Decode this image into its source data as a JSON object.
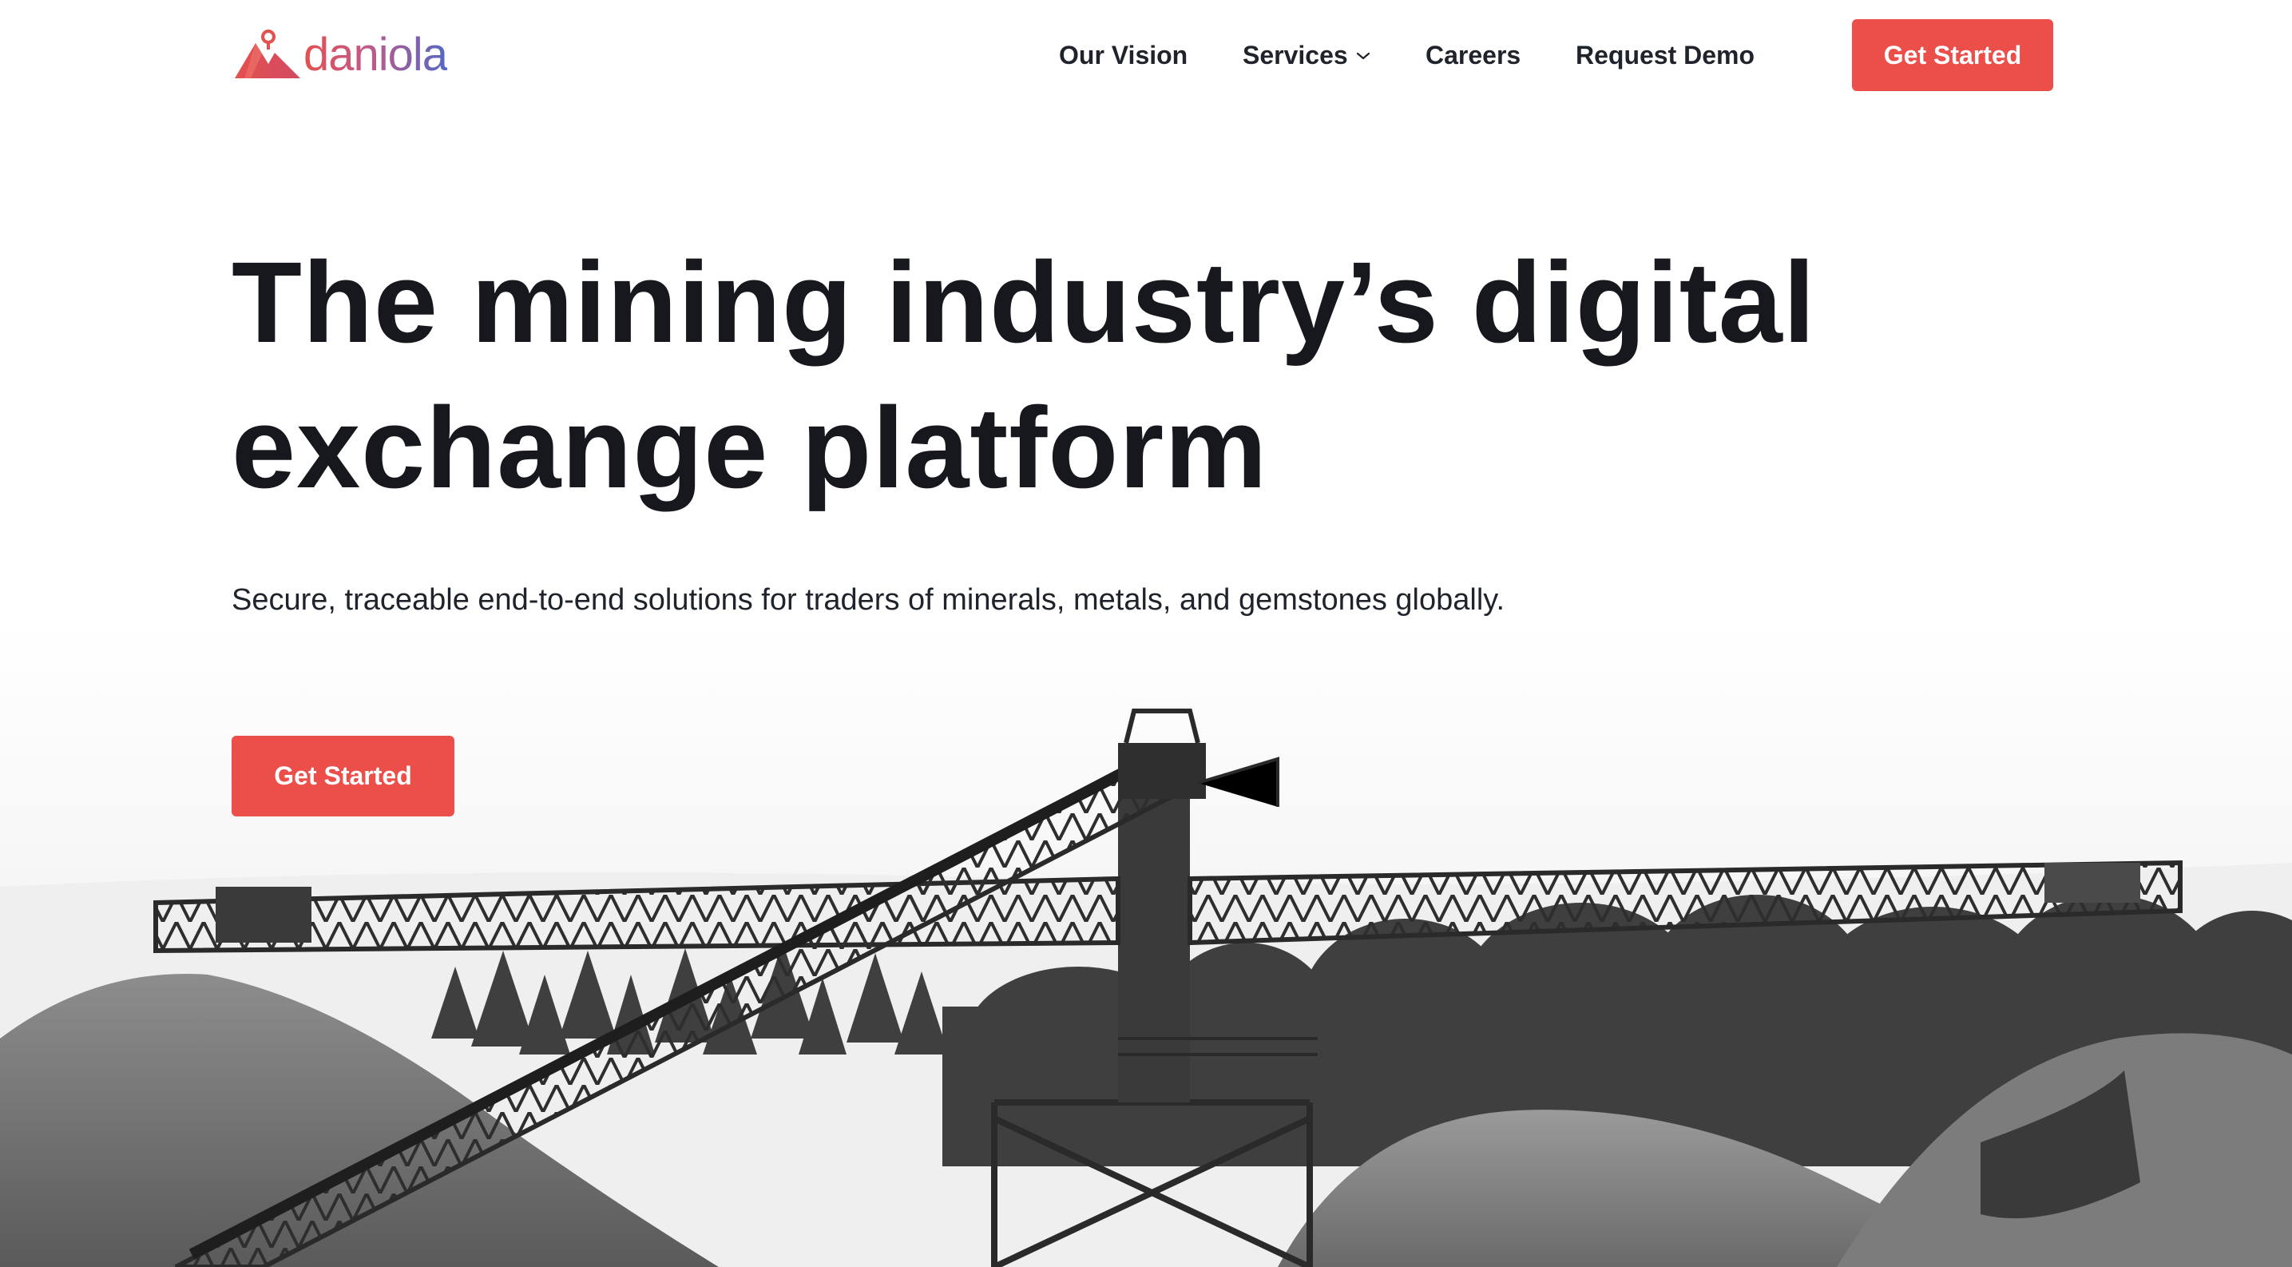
{
  "brand": {
    "name": "daniola",
    "accent_color": "#ec4e4a",
    "logo_icon": "mountain-pin-icon"
  },
  "nav": {
    "items": [
      {
        "label": "Our Vision"
      },
      {
        "label": "Services",
        "icon": "chevron-down-icon"
      },
      {
        "label": "Careers"
      },
      {
        "label": "Request Demo"
      }
    ],
    "cta_label": "Get Started"
  },
  "hero": {
    "title": "The mining industry’s digital exchange platform",
    "subtitle": "Secure, traceable end-to-end solutions for traders of minerals, metals, and gemstones globally.",
    "cta_label": "Get Started"
  }
}
